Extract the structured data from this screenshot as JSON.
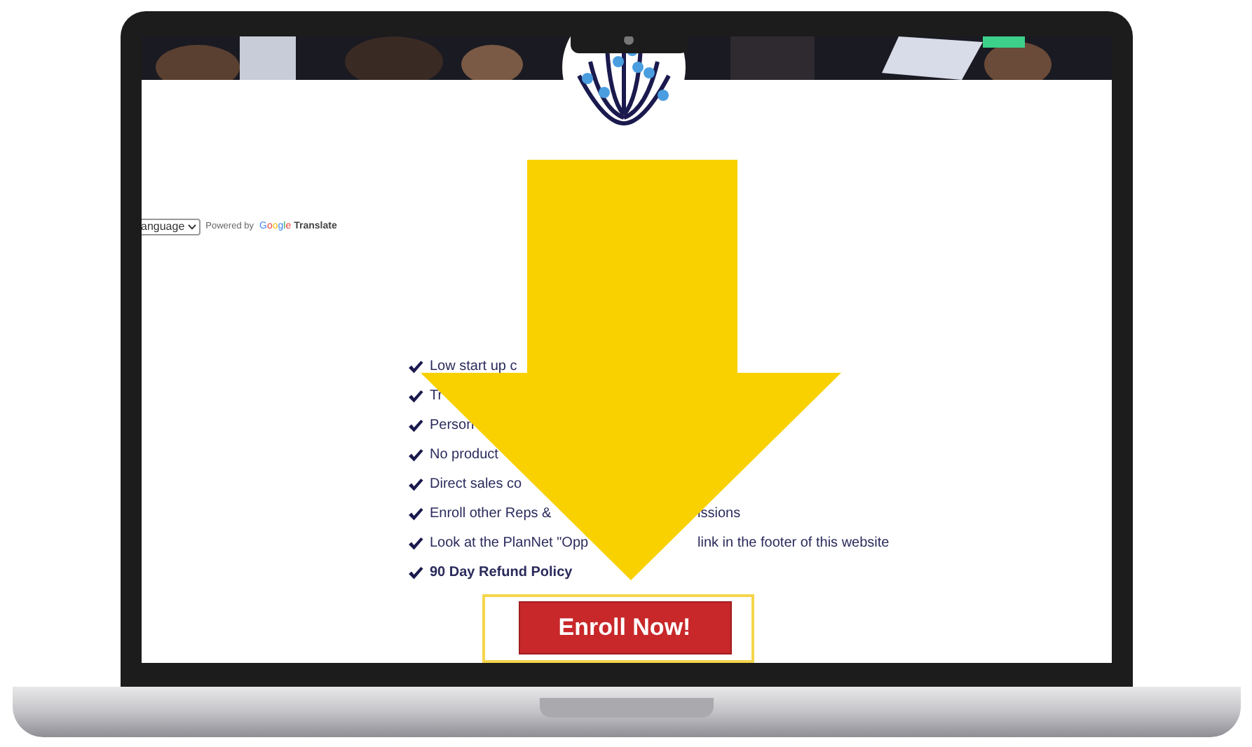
{
  "translate": {
    "language_select": "anguage",
    "powered_by": "Powered by",
    "google": "Google",
    "translate": "Translate"
  },
  "benefits": [
    {
      "texts": [
        "Low start up c"
      ],
      "bold": false
    },
    {
      "texts": [
        "Tr"
      ],
      "bold": false
    },
    {
      "texts": [
        "Person"
      ],
      "bold": false
    },
    {
      "texts": [
        "No product"
      ],
      "bold": false
    },
    {
      "texts": [
        "Direct sales co"
      ],
      "bold": false
    },
    {
      "texts": [
        "Enroll other Reps &",
        "issions"
      ],
      "bold": false
    },
    {
      "texts": [
        "Look at the PlanNet \"Opp",
        "link in the footer of this website"
      ],
      "bold": false
    },
    {
      "texts": [
        "90 Day Refund Policy"
      ],
      "bold": true
    }
  ],
  "enroll_button": "Enroll Now!"
}
